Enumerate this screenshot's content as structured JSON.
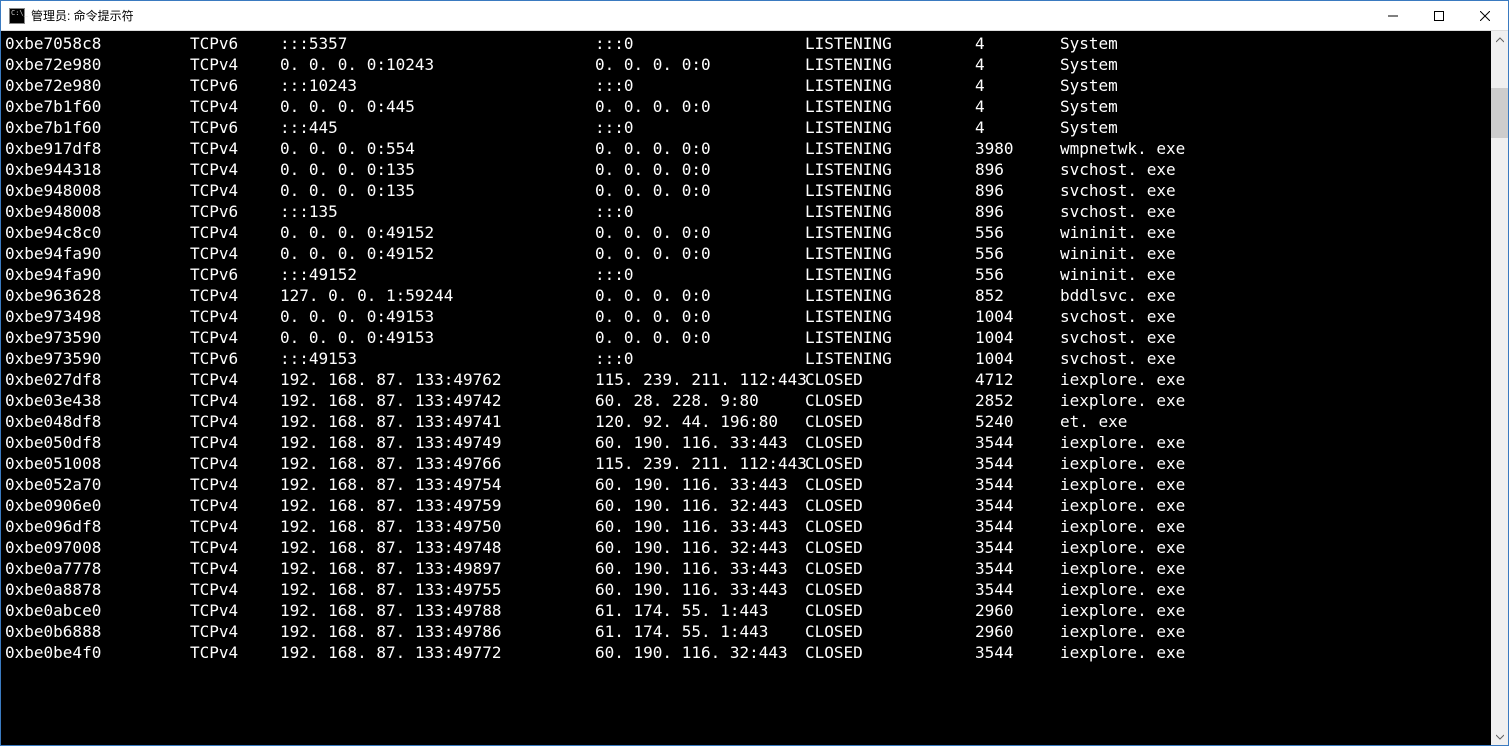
{
  "window": {
    "title": "管理员: 命令提示符"
  },
  "rows": [
    {
      "offset": "0xbe7058c8",
      "proto": "TCPv6",
      "local": ":::5357",
      "remote": ":::0",
      "state": "LISTENING",
      "pid": "4",
      "proc": "System"
    },
    {
      "offset": "0xbe72e980",
      "proto": "TCPv4",
      "local": "0.0.0.0:10243",
      "remote": "0.0.0.0:0",
      "state": "LISTENING",
      "pid": "4",
      "proc": "System"
    },
    {
      "offset": "0xbe72e980",
      "proto": "TCPv6",
      "local": ":::10243",
      "remote": ":::0",
      "state": "LISTENING",
      "pid": "4",
      "proc": "System"
    },
    {
      "offset": "0xbe7b1f60",
      "proto": "TCPv4",
      "local": "0.0.0.0:445",
      "remote": "0.0.0.0:0",
      "state": "LISTENING",
      "pid": "4",
      "proc": "System"
    },
    {
      "offset": "0xbe7b1f60",
      "proto": "TCPv6",
      "local": ":::445",
      "remote": ":::0",
      "state": "LISTENING",
      "pid": "4",
      "proc": "System"
    },
    {
      "offset": "0xbe917df8",
      "proto": "TCPv4",
      "local": "0.0.0.0:554",
      "remote": "0.0.0.0:0",
      "state": "LISTENING",
      "pid": "3980",
      "proc": "wmpnetwk.exe"
    },
    {
      "offset": "0xbe944318",
      "proto": "TCPv4",
      "local": "0.0.0.0:135",
      "remote": "0.0.0.0:0",
      "state": "LISTENING",
      "pid": "896",
      "proc": "svchost.exe"
    },
    {
      "offset": "0xbe948008",
      "proto": "TCPv4",
      "local": "0.0.0.0:135",
      "remote": "0.0.0.0:0",
      "state": "LISTENING",
      "pid": "896",
      "proc": "svchost.exe"
    },
    {
      "offset": "0xbe948008",
      "proto": "TCPv6",
      "local": ":::135",
      "remote": ":::0",
      "state": "LISTENING",
      "pid": "896",
      "proc": "svchost.exe"
    },
    {
      "offset": "0xbe94c8c0",
      "proto": "TCPv4",
      "local": "0.0.0.0:49152",
      "remote": "0.0.0.0:0",
      "state": "LISTENING",
      "pid": "556",
      "proc": "wininit.exe"
    },
    {
      "offset": "0xbe94fa90",
      "proto": "TCPv4",
      "local": "0.0.0.0:49152",
      "remote": "0.0.0.0:0",
      "state": "LISTENING",
      "pid": "556",
      "proc": "wininit.exe"
    },
    {
      "offset": "0xbe94fa90",
      "proto": "TCPv6",
      "local": ":::49152",
      "remote": ":::0",
      "state": "LISTENING",
      "pid": "556",
      "proc": "wininit.exe"
    },
    {
      "offset": "0xbe963628",
      "proto": "TCPv4",
      "local": "127.0.0.1:59244",
      "remote": "0.0.0.0:0",
      "state": "LISTENING",
      "pid": "852",
      "proc": "bddlsvc.exe"
    },
    {
      "offset": "0xbe973498",
      "proto": "TCPv4",
      "local": "0.0.0.0:49153",
      "remote": "0.0.0.0:0",
      "state": "LISTENING",
      "pid": "1004",
      "proc": "svchost.exe"
    },
    {
      "offset": "0xbe973590",
      "proto": "TCPv4",
      "local": "0.0.0.0:49153",
      "remote": "0.0.0.0:0",
      "state": "LISTENING",
      "pid": "1004",
      "proc": "svchost.exe"
    },
    {
      "offset": "0xbe973590",
      "proto": "TCPv6",
      "local": ":::49153",
      "remote": ":::0",
      "state": "LISTENING",
      "pid": "1004",
      "proc": "svchost.exe"
    },
    {
      "offset": "0xbe027df8",
      "proto": "TCPv4",
      "local": "192.168.87.133:49762",
      "remote": "115.239.211.112:443",
      "state": "CLOSED",
      "pid": "4712",
      "proc": "iexplore.exe"
    },
    {
      "offset": "0xbe03e438",
      "proto": "TCPv4",
      "local": "192.168.87.133:49742",
      "remote": "60.28.228.9:80",
      "state": "CLOSED",
      "pid": "2852",
      "proc": "iexplore.exe"
    },
    {
      "offset": "0xbe048df8",
      "proto": "TCPv4",
      "local": "192.168.87.133:49741",
      "remote": "120.92.44.196:80",
      "state": "CLOSED",
      "pid": "5240",
      "proc": "et.exe"
    },
    {
      "offset": "0xbe050df8",
      "proto": "TCPv4",
      "local": "192.168.87.133:49749",
      "remote": "60.190.116.33:443",
      "state": "CLOSED",
      "pid": "3544",
      "proc": "iexplore.exe"
    },
    {
      "offset": "0xbe051008",
      "proto": "TCPv4",
      "local": "192.168.87.133:49766",
      "remote": "115.239.211.112:443",
      "state": "CLOSED",
      "pid": "3544",
      "proc": "iexplore.exe"
    },
    {
      "offset": "0xbe052a70",
      "proto": "TCPv4",
      "local": "192.168.87.133:49754",
      "remote": "60.190.116.33:443",
      "state": "CLOSED",
      "pid": "3544",
      "proc": "iexplore.exe"
    },
    {
      "offset": "0xbe0906e0",
      "proto": "TCPv4",
      "local": "192.168.87.133:49759",
      "remote": "60.190.116.32:443",
      "state": "CLOSED",
      "pid": "3544",
      "proc": "iexplore.exe"
    },
    {
      "offset": "0xbe096df8",
      "proto": "TCPv4",
      "local": "192.168.87.133:49750",
      "remote": "60.190.116.33:443",
      "state": "CLOSED",
      "pid": "3544",
      "proc": "iexplore.exe"
    },
    {
      "offset": "0xbe097008",
      "proto": "TCPv4",
      "local": "192.168.87.133:49748",
      "remote": "60.190.116.32:443",
      "state": "CLOSED",
      "pid": "3544",
      "proc": "iexplore.exe"
    },
    {
      "offset": "0xbe0a7778",
      "proto": "TCPv4",
      "local": "192.168.87.133:49897",
      "remote": "60.190.116.33:443",
      "state": "CLOSED",
      "pid": "3544",
      "proc": "iexplore.exe"
    },
    {
      "offset": "0xbe0a8878",
      "proto": "TCPv4",
      "local": "192.168.87.133:49755",
      "remote": "60.190.116.33:443",
      "state": "CLOSED",
      "pid": "3544",
      "proc": "iexplore.exe"
    },
    {
      "offset": "0xbe0abce0",
      "proto": "TCPv4",
      "local": "192.168.87.133:49788",
      "remote": "61.174.55.1:443",
      "state": "CLOSED",
      "pid": "2960",
      "proc": "iexplore.exe"
    },
    {
      "offset": "0xbe0b6888",
      "proto": "TCPv4",
      "local": "192.168.87.133:49786",
      "remote": "61.174.55.1:443",
      "state": "CLOSED",
      "pid": "2960",
      "proc": "iexplore.exe"
    },
    {
      "offset": "0xbe0be4f0",
      "proto": "TCPv4",
      "local": "192.168.87.133:49772",
      "remote": "60.190.116.32:443",
      "state": "CLOSED",
      "pid": "3544",
      "proc": "iexplore.exe"
    }
  ]
}
